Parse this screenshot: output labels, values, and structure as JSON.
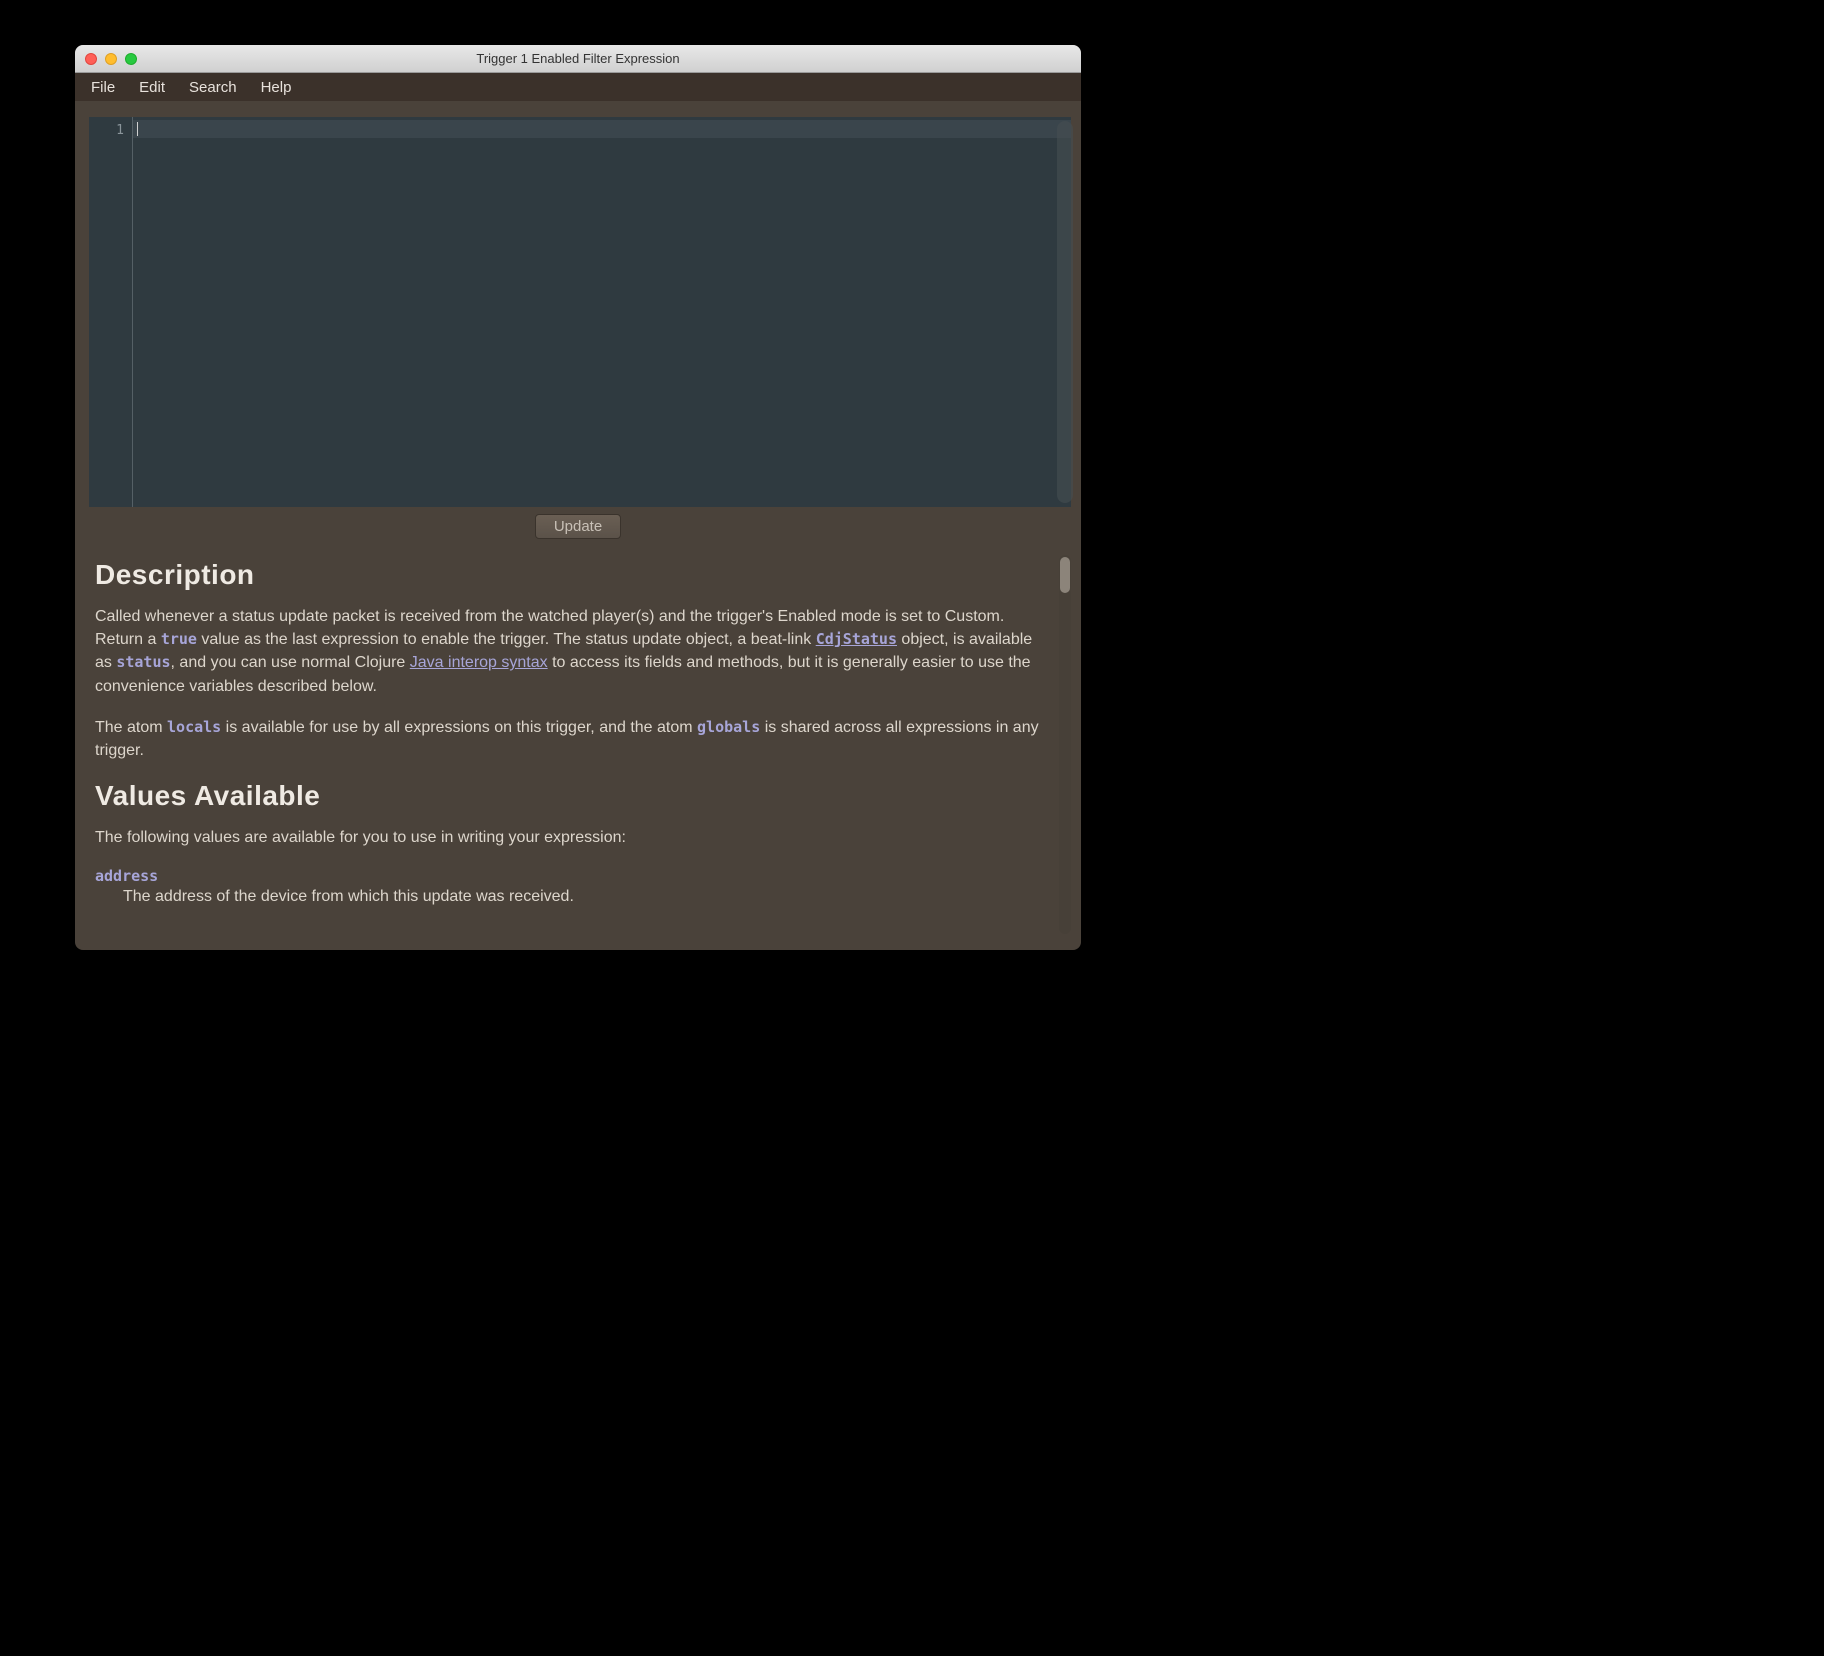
{
  "window": {
    "title": "Trigger 1 Enabled Filter Expression"
  },
  "menu": {
    "file": "File",
    "edit": "Edit",
    "search": "Search",
    "help": "Help"
  },
  "editor": {
    "line1": "1"
  },
  "buttons": {
    "update": "Update"
  },
  "doc": {
    "h_description": "Description",
    "p1_a": "Called whenever a status update packet is received from the watched player(s) and the trigger's Enabled mode is set to Custom. Return a ",
    "code_true": "true",
    "p1_b": " value as the last expression to enable the trigger. The status update object, a beat-link ",
    "link_cdj": "CdjStatus",
    "p1_c": " object, is available as ",
    "code_status": "status",
    "p1_d": ", and you can use normal Clojure ",
    "link_interop": "Java interop syntax",
    "p1_e": " to access its fields and methods, but it is generally easier to use the convenience variables described below.",
    "p2_a": "The atom ",
    "code_locals": "locals",
    "p2_b": " is available for use by all expressions on this trigger, and the atom ",
    "code_globals": "globals",
    "p2_c": " is shared across all expressions in any trigger.",
    "h_values": "Values Available",
    "p3": "The following values are available for you to use in writing your expression:",
    "val1_name": "address",
    "val1_desc": "The address of the device from which this update was received."
  }
}
